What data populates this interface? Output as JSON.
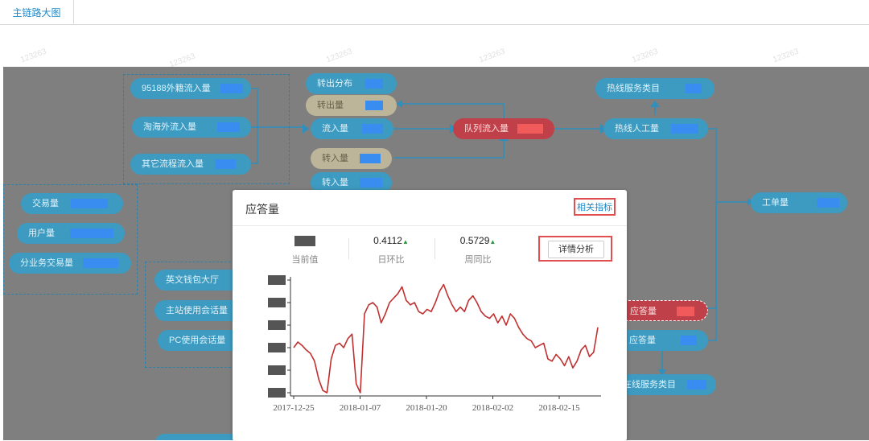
{
  "tabs": [
    {
      "label": "主链路大图"
    }
  ],
  "watermark": "123263",
  "nodes": {
    "n_95188": "95188外籍流入量",
    "n_taohai": "淘海外流入量",
    "n_qita": "其它流程流入量",
    "n_zhuanchu_fenbu": "转出分布",
    "n_zhuanchu": "转出量",
    "n_liuru": "流入量",
    "n_zhuanru1": "转入量",
    "n_zhuanru2": "转入量",
    "n_duilie": "队列流入量",
    "n_rexian_leimu": "热线服务类目",
    "n_rexian_rengong": "热线人工量",
    "n_gongdan": "工单量",
    "n_jiaoyi": "交易量",
    "n_yonghu": "用户量",
    "n_fenyewu": "分业务交易量",
    "n_yingwen": "英文钱包大厅",
    "n_zhuzhan": "主站使用会话量",
    "n_pc": "PC使用会话量",
    "n_yingda_red": "应答量",
    "n_yingda": "应答量",
    "n_zaixian": "在线服务类目"
  },
  "popup": {
    "title": "应答量",
    "related_label": "相关指标",
    "current_label": "当前值",
    "day_ratio_value": "0.4112",
    "day_ratio_label": "日环比",
    "week_ratio_value": "0.5729",
    "week_ratio_label": "周同比",
    "up_glyph": "▲",
    "detail_button": "详情分析"
  },
  "colors": {
    "node_blue": "#3d9ac0",
    "node_red": "#c0404a",
    "line": "#c03030",
    "accent": "#1e88c8"
  },
  "chart_data": {
    "type": "line",
    "x_ticks": [
      "2017-12-25",
      "2018-01-07",
      "2018-01-20",
      "2018-02-02",
      "2018-02-15"
    ],
    "y_tick_labels_redacted": true,
    "ylim": [
      0,
      100
    ],
    "series": [
      {
        "values": [
          40,
          45,
          42,
          38,
          35,
          28,
          12,
          2,
          0,
          30,
          42,
          44,
          40,
          48,
          52,
          8,
          0,
          70,
          78,
          80,
          76,
          62,
          70,
          80,
          84,
          88,
          94,
          82,
          78,
          80,
          72,
          70,
          74,
          72,
          80,
          90,
          96,
          86,
          78,
          72,
          76,
          72,
          82,
          86,
          80,
          72,
          68,
          66,
          70,
          62,
          68,
          60,
          70,
          66,
          58,
          52,
          48,
          46,
          40,
          42,
          44,
          30,
          28,
          34,
          30,
          24,
          32,
          22,
          28,
          38,
          42,
          32,
          36,
          58
        ]
      }
    ]
  }
}
